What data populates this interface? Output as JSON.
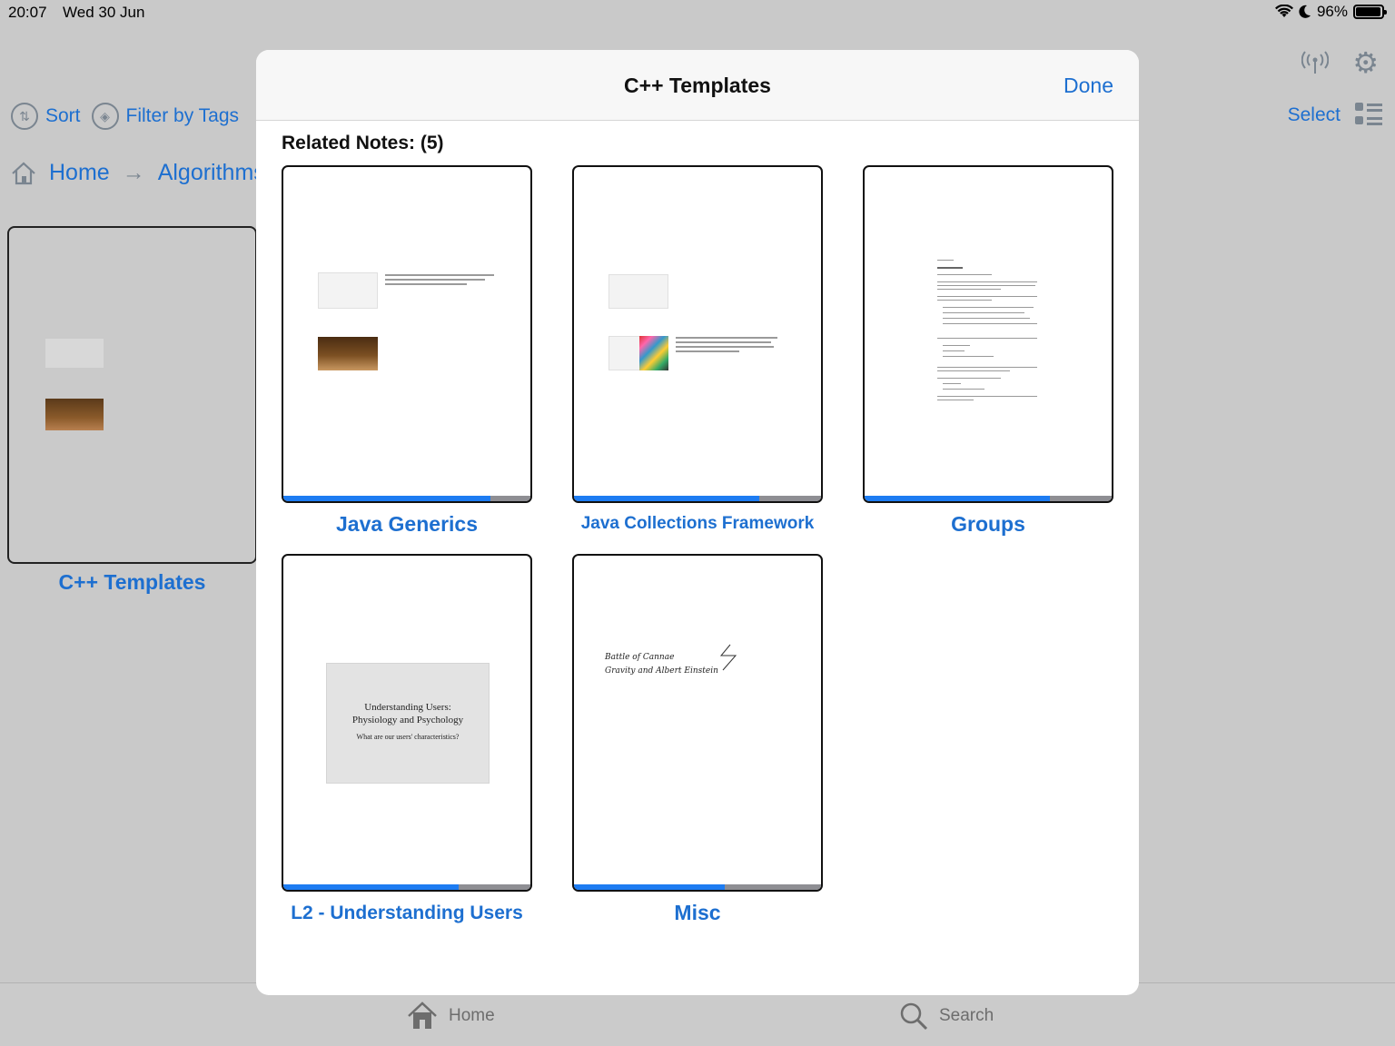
{
  "status_bar": {
    "time": "20:07",
    "date": "Wed 30 Jun",
    "battery": "96%",
    "battery_level": 0.96
  },
  "background": {
    "toolbar": {
      "sort_label": "Sort",
      "filter_label": "Filter by Tags",
      "select_label": "Select"
    },
    "breadcrumb": {
      "home": "Home",
      "current": "Algorithms"
    },
    "card_title": "C++ Templates"
  },
  "tab_bar": {
    "home": "Home",
    "search": "Search"
  },
  "modal": {
    "title": "C++ Templates",
    "done_label": "Done",
    "related_heading": "Related Notes: (5)",
    "notes": [
      {
        "title": "Java Generics",
        "progress": 0.84
      },
      {
        "title": "Java Collections Framework",
        "progress": 0.75
      },
      {
        "title": "Groups",
        "progress": 0.75
      },
      {
        "title": "L2 - Understanding Users",
        "progress": 0.71,
        "slide_lines": [
          "Understanding Users:",
          "Physiology and Psychology",
          "What are our users' characteristics?"
        ]
      },
      {
        "title": "Misc",
        "progress": 0.61,
        "handwriting": [
          "Battle of Cannae",
          "Gravity and Albert Einstein"
        ]
      }
    ]
  },
  "colors": {
    "accent": "#1d6fd0",
    "progress_fill": "#1d7cf2",
    "progress_track": "#8e8e93"
  },
  "icons": [
    "wifi-icon",
    "moon-icon",
    "battery-icon",
    "sort-icon",
    "tag-icon",
    "home-icon",
    "arrow-right-icon",
    "antenna-icon",
    "gear-icon",
    "list-view-icon",
    "search-icon"
  ]
}
